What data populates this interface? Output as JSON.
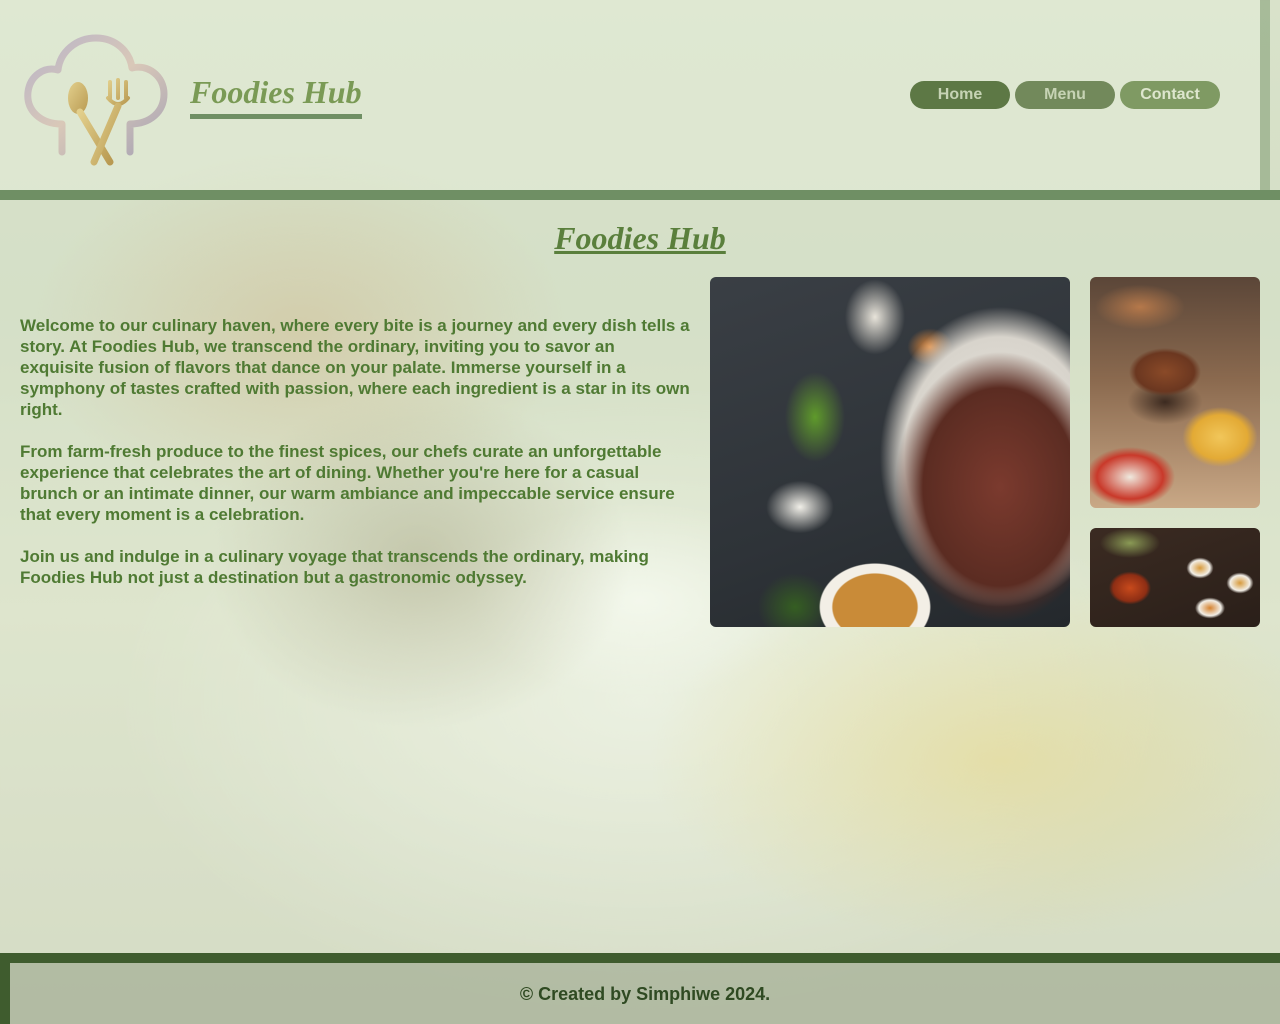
{
  "header": {
    "brand": "Foodies Hub",
    "nav": [
      {
        "label": "Home"
      },
      {
        "label": "Menu"
      },
      {
        "label": "Contact"
      }
    ]
  },
  "main": {
    "title": "Foodies Hub",
    "paragraphs": [
      "Welcome to our culinary haven, where every bite is a journey and every dish tells a story. At Foodies Hub, we transcend the ordinary, inviting you to savor an exquisite fusion of flavors that dance on your palate. Immerse yourself in a symphony of tastes crafted with passion, where each ingredient is a star in its own right.",
      "From farm-fresh produce to the finest spices, our chefs curate an unforgettable experience that celebrates the art of dining. Whether you're here for a casual brunch or an intimate dinner, our warm ambiance and impeccable service ensure that every moment is a celebration.",
      "Join us and indulge in a culinary voyage that transcends the ordinary, making Foodies Hub not just a destination but a gastronomic odyssey."
    ]
  },
  "footer": {
    "text": "© Created by Simphiwe 2024."
  },
  "colors": {
    "accent_green": "#6f8f64",
    "nav_button": "#46642d",
    "text_green": "#4f7a33",
    "footer_bar": "#3f5c2e"
  },
  "icons": {
    "logo": "chef-hat-cutlery-icon"
  }
}
